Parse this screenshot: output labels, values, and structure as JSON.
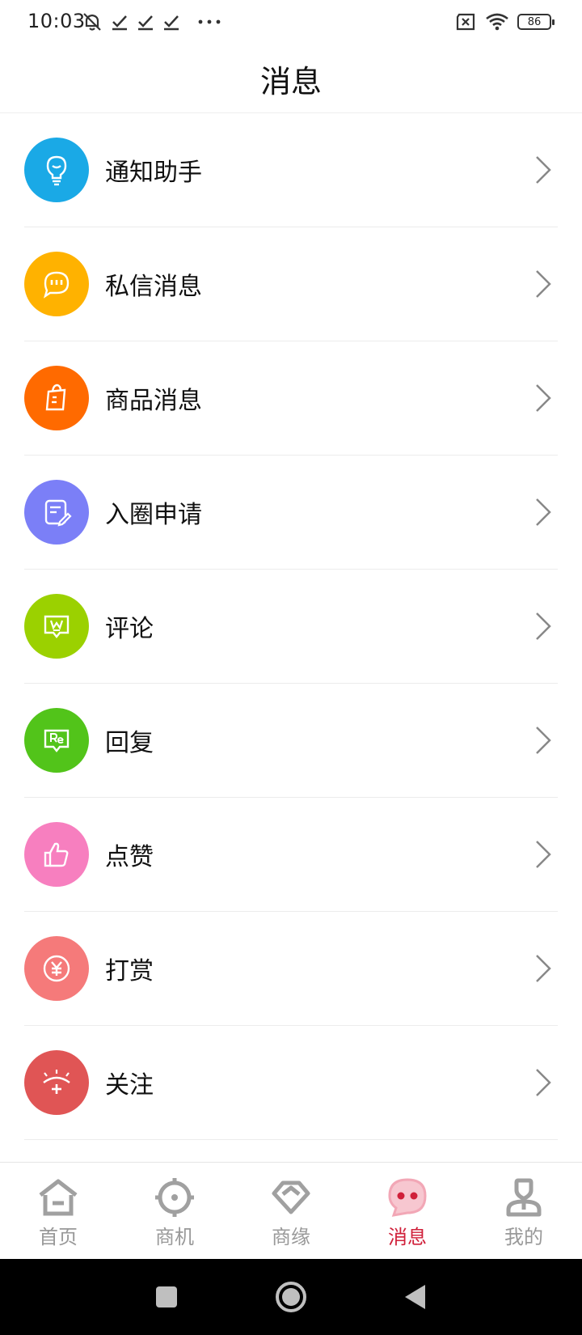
{
  "status_bar": {
    "time": "10:03",
    "battery": "86",
    "left_icons": [
      "muted-bell-icon",
      "check-icon",
      "check-icon",
      "check-icon",
      "more-dots-icon"
    ],
    "right_icons": [
      "no-sim-icon",
      "wifi-icon",
      "battery-icon"
    ]
  },
  "header": {
    "title": "消息"
  },
  "list": {
    "items": [
      {
        "label": "通知助手",
        "icon": "lightbulb-icon",
        "color": "#1aa9e6"
      },
      {
        "label": "私信消息",
        "icon": "chat-bubble-icon",
        "color": "#ffb200"
      },
      {
        "label": "商品消息",
        "icon": "shopping-bag-icon",
        "color": "#ff6a00"
      },
      {
        "label": "入圈申请",
        "icon": "form-edit-icon",
        "color": "#7b7ff7"
      },
      {
        "label": "评论",
        "icon": "comment-icon",
        "color": "#9bd100"
      },
      {
        "label": "回复",
        "icon": "reply-icon",
        "color": "#52c41a"
      },
      {
        "label": "点赞",
        "icon": "thumbs-up-icon",
        "color": "#f77fbf"
      },
      {
        "label": "打赏",
        "icon": "yen-coin-icon",
        "color": "#f57a7a"
      },
      {
        "label": "关注",
        "icon": "eye-plus-icon",
        "color": "#e05555"
      }
    ]
  },
  "tabbar": {
    "active_color": "#d0203a",
    "inactive_color": "#999999",
    "tabs": [
      {
        "label": "首页",
        "icon": "home-icon",
        "active": false
      },
      {
        "label": "商机",
        "icon": "target-icon",
        "active": false
      },
      {
        "label": "商缘",
        "icon": "handshake-icon",
        "active": false
      },
      {
        "label": "消息",
        "icon": "message-icon",
        "active": true
      },
      {
        "label": "我的",
        "icon": "profile-icon",
        "active": false
      }
    ]
  }
}
